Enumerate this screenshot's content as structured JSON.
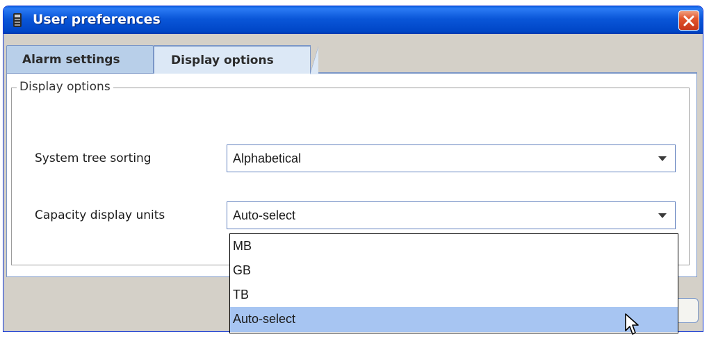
{
  "window": {
    "title": "User preferences"
  },
  "tabs": [
    {
      "label": "Alarm settings",
      "active": false
    },
    {
      "label": "Display options",
      "active": true
    }
  ],
  "group": {
    "title": "Display options"
  },
  "fields": {
    "sorting": {
      "label": "System tree sorting",
      "value": "Alphabetical"
    },
    "capacity": {
      "label": "Capacity display units",
      "value": "Auto-select"
    }
  },
  "dropdown": {
    "options": [
      "MB",
      "GB",
      "TB",
      "Auto-select"
    ],
    "highlighted": "Auto-select"
  },
  "colors": {
    "titlebar": "#0a56d8",
    "close": "#e2552c",
    "highlight": "#a7c5f2"
  },
  "icons": [
    "app-icon",
    "close-icon",
    "chevron-down-icon",
    "mouse-cursor-icon"
  ]
}
